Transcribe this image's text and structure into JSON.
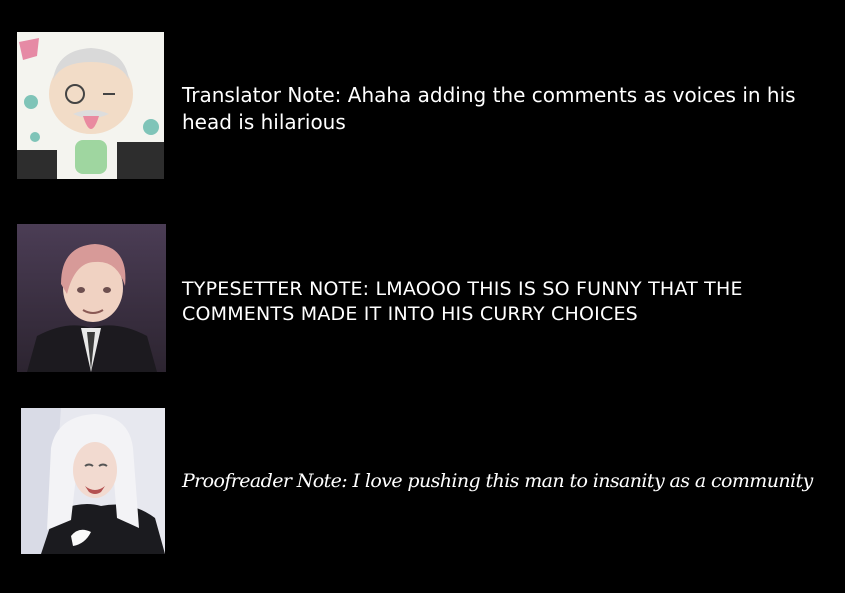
{
  "notes": [
    {
      "role": "translator",
      "text": "Translator Note: Ahaha adding the comments as voices in his head is hilarious",
      "avatar_icon": "old-man-portrait"
    },
    {
      "role": "typesetter",
      "text": "TYPESETTER NOTE: LMAOOO THIS IS SO FUNNY THAT THE COMMENTS MADE IT INTO HIS CURRY CHOICES",
      "avatar_icon": "pink-haired-man-portrait"
    },
    {
      "role": "proofreader",
      "text": "Proofreader Note: I love pushing this man to insanity as a community",
      "avatar_icon": "white-haired-man-portrait"
    }
  ],
  "colors": {
    "background": "#000000",
    "text": "#ffffff"
  }
}
